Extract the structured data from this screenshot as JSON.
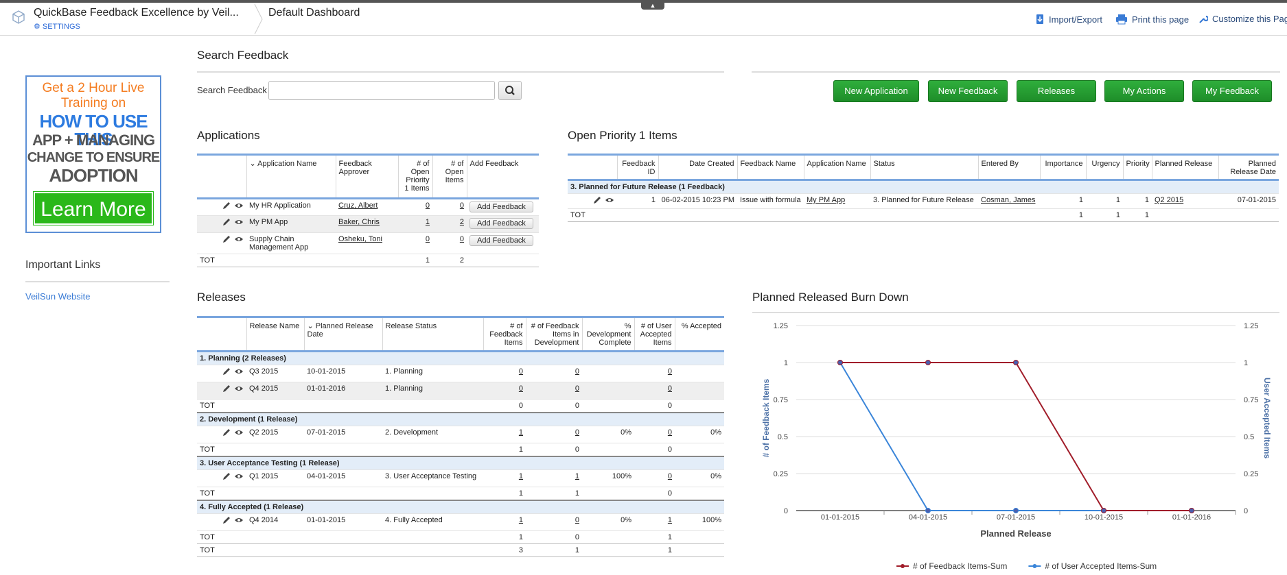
{
  "header": {
    "app_title": "QuickBase Feedback Excellence by Veil...",
    "settings_label": "SETTINGS",
    "dashboard_title": "Default Dashboard",
    "actions": [
      "Import/Export",
      "Print this page",
      "Customize this Pag"
    ]
  },
  "sidebar": {
    "promo": {
      "line1": "Get a 2 Hour Live Training on",
      "line2": "HOW TO USE THIS",
      "line3": "APP + MANAGING",
      "line4": "CHANGE TO ENSURE",
      "line5": "ADOPTION",
      "button": "Learn More"
    },
    "important_links_title": "Important Links",
    "links": [
      "VeilSun Website"
    ]
  },
  "search": {
    "section_title": "Search Feedback",
    "label": "Search Feedback",
    "value": ""
  },
  "buttons": [
    "New Application",
    "New Feedback",
    "Releases",
    "My Actions",
    "My Feedback"
  ],
  "applications": {
    "title": "Applications",
    "columns": [
      "Application Name",
      "Feedback Approver",
      "# of Open Priority 1 Items",
      "# of Open Items",
      "Add Feedback"
    ],
    "rows": [
      {
        "name": "My HR Application",
        "approver": "Cruz, Albert",
        "p1": "0",
        "open": "0",
        "add": "Add Feedback"
      },
      {
        "name": "My PM App",
        "approver": "Baker, Chris",
        "p1": "1",
        "open": "2",
        "add": "Add Feedback"
      },
      {
        "name": "Supply Chain Management App",
        "approver": "Osheku, Toni",
        "p1": "0",
        "open": "0",
        "add": "Add Feedback"
      }
    ],
    "total": {
      "label": "TOT",
      "p1": "1",
      "open": "2"
    }
  },
  "priority": {
    "title": "Open Priority 1 Items",
    "columns": [
      "Feedback ID",
      "Date Created",
      "Feedback Name",
      "Application Name",
      "Status",
      "Entered By",
      "Importance",
      "Urgency",
      "Priority",
      "Planned Release",
      "Planned Release Date"
    ],
    "group": "3. Planned for Future Release  (1 Feedback)",
    "rows": [
      {
        "id": "1",
        "date": "06-02-2015 10:23 PM",
        "name": "Issue with formula",
        "app": "My PM App",
        "status": "3. Planned for Future Release",
        "entered": "Cosman, James",
        "importance": "1",
        "urgency": "1",
        "priority": "1",
        "release": "Q2 2015",
        "release_date": "07-01-2015"
      }
    ],
    "total": {
      "label": "TOT",
      "importance": "1",
      "urgency": "1",
      "priority": "1"
    }
  },
  "releases": {
    "title": "Releases",
    "columns": [
      "Release Name",
      "Planned Release Date",
      "Release Status",
      "# of Feedback Items",
      "# of Feedback Items in Development",
      "% Development Complete",
      "# of User Accepted Items",
      "% Accepted"
    ],
    "groups": [
      {
        "label": "1. Planning  (2 Releases)",
        "rows": [
          {
            "name": "Q3 2015",
            "date": "10-01-2015",
            "status": "1. Planning",
            "fb": "0",
            "dev": "0",
            "pct_dev": "",
            "ua": "0",
            "pct_acc": ""
          },
          {
            "name": "Q4 2015",
            "date": "01-01-2016",
            "status": "1. Planning",
            "fb": "0",
            "dev": "0",
            "pct_dev": "",
            "ua": "0",
            "pct_acc": ""
          }
        ],
        "tot": {
          "label": "TOT",
          "fb": "0",
          "dev": "0",
          "ua": "0"
        }
      },
      {
        "label": "2. Development  (1 Release)",
        "rows": [
          {
            "name": "Q2 2015",
            "date": "07-01-2015",
            "status": "2. Development",
            "fb": "1",
            "dev": "0",
            "pct_dev": "0%",
            "ua": "0",
            "pct_acc": "0%"
          }
        ],
        "tot": {
          "label": "TOT",
          "fb": "1",
          "dev": "0",
          "ua": "0"
        }
      },
      {
        "label": "3. User Acceptance Testing  (1 Release)",
        "rows": [
          {
            "name": "Q1 2015",
            "date": "04-01-2015",
            "status": "3. User Acceptance Testing",
            "fb": "1",
            "dev": "1",
            "pct_dev": "100%",
            "ua": "0",
            "pct_acc": "0%"
          }
        ],
        "tot": {
          "label": "TOT",
          "fb": "1",
          "dev": "1",
          "ua": "0"
        }
      },
      {
        "label": "4. Fully Accepted  (1 Release)",
        "rows": [
          {
            "name": "Q4 2014",
            "date": "01-01-2015",
            "status": "4. Fully Accepted",
            "fb": "1",
            "dev": "0",
            "pct_dev": "0%",
            "ua": "1",
            "pct_acc": "100%"
          }
        ],
        "tot": {
          "label": "TOT",
          "fb": "1",
          "dev": "0",
          "ua": "1"
        }
      }
    ],
    "grand_total": {
      "label": "TOT",
      "fb": "3",
      "dev": "1",
      "ua": "1"
    }
  },
  "chart_data": {
    "type": "line",
    "title": "Planned Released Burn Down",
    "xlabel": "Planned Release",
    "ylabel": "# of Feedback Items",
    "y2label": "User Accepted Items",
    "x": [
      "01-01-2015",
      "04-01-2015",
      "07-01-2015",
      "10-01-2015",
      "01-01-2016"
    ],
    "yticks": [
      "0",
      "0.25",
      "0.5",
      "0.75",
      "1",
      "1.25"
    ],
    "ylim": [
      0,
      1.25
    ],
    "grid": true,
    "legend_position": "bottom",
    "series": [
      {
        "name": "# of Feedback Items-Sum",
        "color": "#a11d2a",
        "values": [
          1,
          1,
          1,
          0,
          0
        ]
      },
      {
        "name": "# of User Accepted Items-Sum",
        "color": "#3a85d9",
        "values": [
          1,
          0,
          0,
          0,
          0
        ]
      }
    ]
  },
  "colors": {
    "accent_green": "#23a032",
    "link_blue": "#2d6bd8",
    "table_rule": "#7aa6de"
  }
}
